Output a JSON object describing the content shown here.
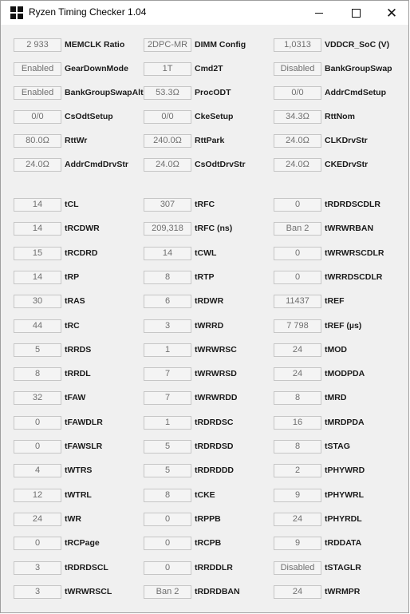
{
  "window": {
    "title": "Ryzen Timing Checker 1.04",
    "icon": "windows-logo-icon",
    "controls": [
      "minimize-icon",
      "maximize-icon",
      "close-icon"
    ]
  },
  "config_rows": [
    [
      {
        "value": "2 933",
        "label": "MEMCLK Ratio"
      },
      {
        "value": "2DPC-MR",
        "label": "DIMM Config"
      },
      {
        "value": "1,0313",
        "label": "VDDCR_SoC (V)"
      }
    ],
    [
      {
        "value": "Enabled",
        "label": "GearDownMode"
      },
      {
        "value": "1T",
        "label": "Cmd2T"
      },
      {
        "value": "Disabled",
        "label": "BankGroupSwap"
      }
    ],
    [
      {
        "value": "Enabled",
        "label": "BankGroupSwapAlt"
      },
      {
        "value": "53.3Ω",
        "label": "ProcODT"
      },
      {
        "value": "0/0",
        "label": "AddrCmdSetup"
      }
    ],
    [
      {
        "value": "0/0",
        "label": "CsOdtSetup"
      },
      {
        "value": "0/0",
        "label": "CkeSetup"
      },
      {
        "value": "34.3Ω",
        "label": "RttNom"
      }
    ],
    [
      {
        "value": "80.0Ω",
        "label": "RttWr"
      },
      {
        "value": "240.0Ω",
        "label": "RttPark"
      },
      {
        "value": "24.0Ω",
        "label": "CLKDrvStr"
      }
    ],
    [
      {
        "value": "24.0Ω",
        "label": "AddrCmdDrvStr"
      },
      {
        "value": "24.0Ω",
        "label": "CsOdtDrvStr"
      },
      {
        "value": "24.0Ω",
        "label": "CKEDrvStr"
      }
    ]
  ],
  "timing_rows": [
    [
      {
        "value": "14",
        "label": "tCL"
      },
      {
        "value": "307",
        "label": "tRFC"
      },
      {
        "value": "0",
        "label": "tRDRDSCDLR"
      }
    ],
    [
      {
        "value": "14",
        "label": "tRCDWR"
      },
      {
        "value": "209,318",
        "label": "tRFC (ns)"
      },
      {
        "value": "Ban 2",
        "label": "tWRWRBAN"
      }
    ],
    [
      {
        "value": "15",
        "label": "tRCDRD"
      },
      {
        "value": "14",
        "label": "tCWL"
      },
      {
        "value": "0",
        "label": "tWRWRSCDLR"
      }
    ],
    [
      {
        "value": "14",
        "label": "tRP"
      },
      {
        "value": "8",
        "label": "tRTP"
      },
      {
        "value": "0",
        "label": "tWRRDSCDLR"
      }
    ],
    [
      {
        "value": "30",
        "label": "tRAS"
      },
      {
        "value": "6",
        "label": "tRDWR"
      },
      {
        "value": "11437",
        "label": "tREF"
      }
    ],
    [
      {
        "value": "44",
        "label": "tRC"
      },
      {
        "value": "3",
        "label": "tWRRD"
      },
      {
        "value": "7 798",
        "label": "tREF (µs)"
      }
    ],
    [
      {
        "value": "5",
        "label": "tRRDS"
      },
      {
        "value": "1",
        "label": "tWRWRSC"
      },
      {
        "value": "24",
        "label": "tMOD"
      }
    ],
    [
      {
        "value": "8",
        "label": "tRRDL"
      },
      {
        "value": "7",
        "label": "tWRWRSD"
      },
      {
        "value": "24",
        "label": "tMODPDA"
      }
    ],
    [
      {
        "value": "32",
        "label": "tFAW"
      },
      {
        "value": "7",
        "label": "tWRWRDD"
      },
      {
        "value": "8",
        "label": "tMRD"
      }
    ],
    [
      {
        "value": "0",
        "label": "tFAWDLR"
      },
      {
        "value": "1",
        "label": "tRDRDSC"
      },
      {
        "value": "16",
        "label": "tMRDPDA"
      }
    ],
    [
      {
        "value": "0",
        "label": "tFAWSLR"
      },
      {
        "value": "5",
        "label": "tRDRDSD"
      },
      {
        "value": "8",
        "label": "tSTAG"
      }
    ],
    [
      {
        "value": "4",
        "label": "tWTRS"
      },
      {
        "value": "5",
        "label": "tRDRDDD"
      },
      {
        "value": "2",
        "label": "tPHYWRD"
      }
    ],
    [
      {
        "value": "12",
        "label": "tWTRL"
      },
      {
        "value": "8",
        "label": "tCKE"
      },
      {
        "value": "9",
        "label": "tPHYWRL"
      }
    ],
    [
      {
        "value": "24",
        "label": "tWR"
      },
      {
        "value": "0",
        "label": "tRPPB"
      },
      {
        "value": "24",
        "label": "tPHYRDL"
      }
    ],
    [
      {
        "value": "0",
        "label": "tRCPage"
      },
      {
        "value": "0",
        "label": "tRCPB"
      },
      {
        "value": "9",
        "label": "tRDDATA"
      }
    ],
    [
      {
        "value": "3",
        "label": "tRDRDSCL"
      },
      {
        "value": "0",
        "label": "tRRDDLR"
      },
      {
        "value": "Disabled",
        "label": "tSTAGLR"
      }
    ],
    [
      {
        "value": "3",
        "label": "tWRWRSCL"
      },
      {
        "value": "Ban 2",
        "label": "tRDRDBAN"
      },
      {
        "value": "24",
        "label": "tWRMPR"
      }
    ]
  ]
}
